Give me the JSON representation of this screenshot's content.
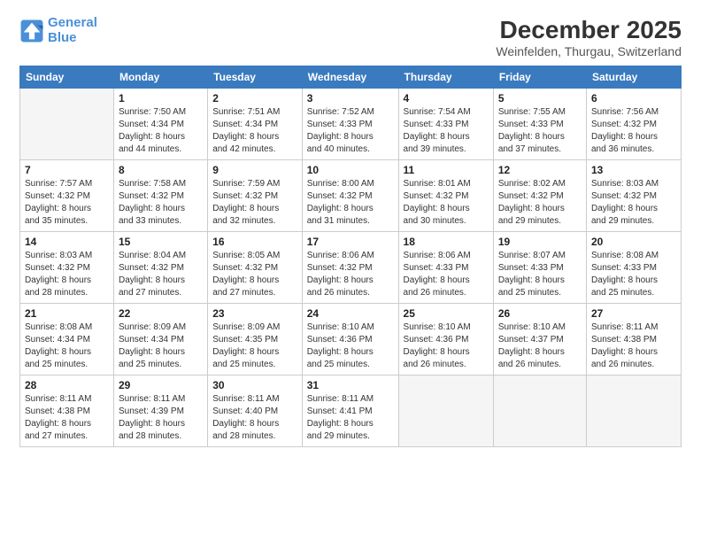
{
  "logo": {
    "line1": "General",
    "line2": "Blue"
  },
  "title": "December 2025",
  "subtitle": "Weinfelden, Thurgau, Switzerland",
  "days_of_week": [
    "Sunday",
    "Monday",
    "Tuesday",
    "Wednesday",
    "Thursday",
    "Friday",
    "Saturday"
  ],
  "weeks": [
    [
      {
        "day": "",
        "info": ""
      },
      {
        "day": "1",
        "info": "Sunrise: 7:50 AM\nSunset: 4:34 PM\nDaylight: 8 hours\nand 44 minutes."
      },
      {
        "day": "2",
        "info": "Sunrise: 7:51 AM\nSunset: 4:34 PM\nDaylight: 8 hours\nand 42 minutes."
      },
      {
        "day": "3",
        "info": "Sunrise: 7:52 AM\nSunset: 4:33 PM\nDaylight: 8 hours\nand 40 minutes."
      },
      {
        "day": "4",
        "info": "Sunrise: 7:54 AM\nSunset: 4:33 PM\nDaylight: 8 hours\nand 39 minutes."
      },
      {
        "day": "5",
        "info": "Sunrise: 7:55 AM\nSunset: 4:33 PM\nDaylight: 8 hours\nand 37 minutes."
      },
      {
        "day": "6",
        "info": "Sunrise: 7:56 AM\nSunset: 4:32 PM\nDaylight: 8 hours\nand 36 minutes."
      }
    ],
    [
      {
        "day": "7",
        "info": "Sunrise: 7:57 AM\nSunset: 4:32 PM\nDaylight: 8 hours\nand 35 minutes."
      },
      {
        "day": "8",
        "info": "Sunrise: 7:58 AM\nSunset: 4:32 PM\nDaylight: 8 hours\nand 33 minutes."
      },
      {
        "day": "9",
        "info": "Sunrise: 7:59 AM\nSunset: 4:32 PM\nDaylight: 8 hours\nand 32 minutes."
      },
      {
        "day": "10",
        "info": "Sunrise: 8:00 AM\nSunset: 4:32 PM\nDaylight: 8 hours\nand 31 minutes."
      },
      {
        "day": "11",
        "info": "Sunrise: 8:01 AM\nSunset: 4:32 PM\nDaylight: 8 hours\nand 30 minutes."
      },
      {
        "day": "12",
        "info": "Sunrise: 8:02 AM\nSunset: 4:32 PM\nDaylight: 8 hours\nand 29 minutes."
      },
      {
        "day": "13",
        "info": "Sunrise: 8:03 AM\nSunset: 4:32 PM\nDaylight: 8 hours\nand 29 minutes."
      }
    ],
    [
      {
        "day": "14",
        "info": "Sunrise: 8:03 AM\nSunset: 4:32 PM\nDaylight: 8 hours\nand 28 minutes."
      },
      {
        "day": "15",
        "info": "Sunrise: 8:04 AM\nSunset: 4:32 PM\nDaylight: 8 hours\nand 27 minutes."
      },
      {
        "day": "16",
        "info": "Sunrise: 8:05 AM\nSunset: 4:32 PM\nDaylight: 8 hours\nand 27 minutes."
      },
      {
        "day": "17",
        "info": "Sunrise: 8:06 AM\nSunset: 4:32 PM\nDaylight: 8 hours\nand 26 minutes."
      },
      {
        "day": "18",
        "info": "Sunrise: 8:06 AM\nSunset: 4:33 PM\nDaylight: 8 hours\nand 26 minutes."
      },
      {
        "day": "19",
        "info": "Sunrise: 8:07 AM\nSunset: 4:33 PM\nDaylight: 8 hours\nand 25 minutes."
      },
      {
        "day": "20",
        "info": "Sunrise: 8:08 AM\nSunset: 4:33 PM\nDaylight: 8 hours\nand 25 minutes."
      }
    ],
    [
      {
        "day": "21",
        "info": "Sunrise: 8:08 AM\nSunset: 4:34 PM\nDaylight: 8 hours\nand 25 minutes."
      },
      {
        "day": "22",
        "info": "Sunrise: 8:09 AM\nSunset: 4:34 PM\nDaylight: 8 hours\nand 25 minutes."
      },
      {
        "day": "23",
        "info": "Sunrise: 8:09 AM\nSunset: 4:35 PM\nDaylight: 8 hours\nand 25 minutes."
      },
      {
        "day": "24",
        "info": "Sunrise: 8:10 AM\nSunset: 4:36 PM\nDaylight: 8 hours\nand 25 minutes."
      },
      {
        "day": "25",
        "info": "Sunrise: 8:10 AM\nSunset: 4:36 PM\nDaylight: 8 hours\nand 26 minutes."
      },
      {
        "day": "26",
        "info": "Sunrise: 8:10 AM\nSunset: 4:37 PM\nDaylight: 8 hours\nand 26 minutes."
      },
      {
        "day": "27",
        "info": "Sunrise: 8:11 AM\nSunset: 4:38 PM\nDaylight: 8 hours\nand 26 minutes."
      }
    ],
    [
      {
        "day": "28",
        "info": "Sunrise: 8:11 AM\nSunset: 4:38 PM\nDaylight: 8 hours\nand 27 minutes."
      },
      {
        "day": "29",
        "info": "Sunrise: 8:11 AM\nSunset: 4:39 PM\nDaylight: 8 hours\nand 28 minutes."
      },
      {
        "day": "30",
        "info": "Sunrise: 8:11 AM\nSunset: 4:40 PM\nDaylight: 8 hours\nand 28 minutes."
      },
      {
        "day": "31",
        "info": "Sunrise: 8:11 AM\nSunset: 4:41 PM\nDaylight: 8 hours\nand 29 minutes."
      },
      {
        "day": "",
        "info": ""
      },
      {
        "day": "",
        "info": ""
      },
      {
        "day": "",
        "info": ""
      }
    ]
  ]
}
